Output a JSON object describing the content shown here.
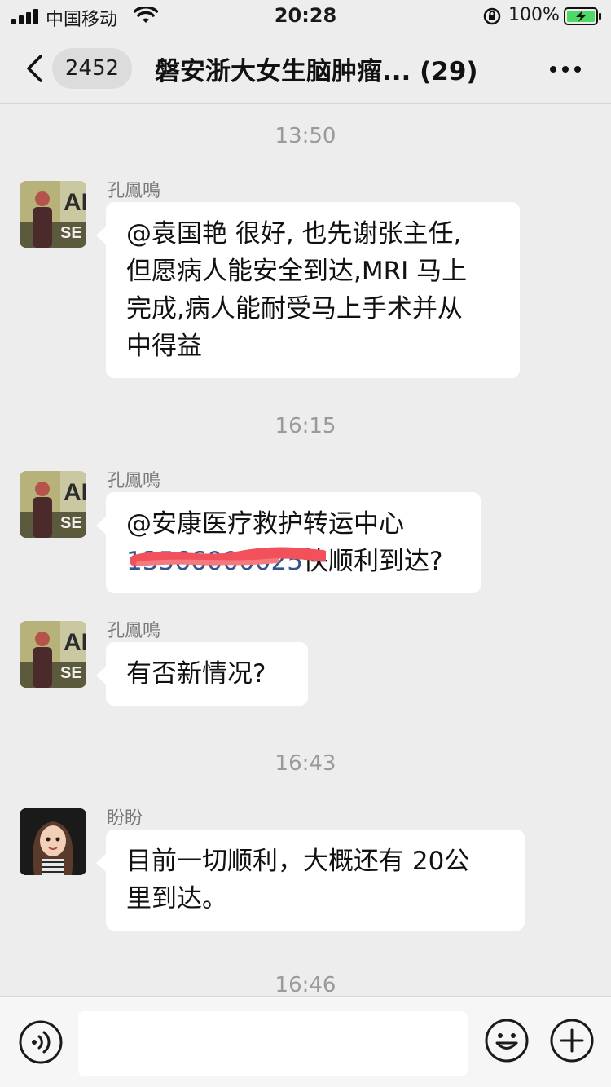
{
  "status_bar": {
    "carrier": "中国移动",
    "time": "20:28",
    "battery": "100%"
  },
  "header": {
    "unread_count": "2452",
    "title": "磐安浙大女生脑肿瘤... (29)"
  },
  "messages": [
    {
      "timestamp": "13:50",
      "sender": "孔鳳鳴",
      "lines": [
        "@袁国艳 很好, 也先谢张主任,",
        "但愿病人能安全到达,MRI 马上",
        "完成,病人能耐受马上手术并从",
        "中得益"
      ]
    },
    {
      "timestamp": "16:15",
      "sender": "孔鳳鳴",
      "line1": "@安康医疗救护转运中心",
      "redacted_part": "13566000025",
      "line2_suffix": "快顺利到达?"
    },
    {
      "sender": "孔鳳鳴",
      "lines": [
        "有否新情况?"
      ]
    },
    {
      "timestamp": "16:43",
      "sender": "盼盼",
      "lines": [
        "目前一切顺利，大概还有 20公",
        "里到达。"
      ]
    },
    {
      "timestamp": "16:46"
    }
  ],
  "colors": {
    "background": "#ededed",
    "bubble": "#ffffff",
    "battery_green": "#4cd964",
    "redaction_red": "#f2505a"
  },
  "icons": {
    "back": "chevron-left-icon",
    "more": "more-dots-icon",
    "voice": "voice-icon",
    "emoji": "emoji-icon",
    "plus": "plus-icon"
  }
}
